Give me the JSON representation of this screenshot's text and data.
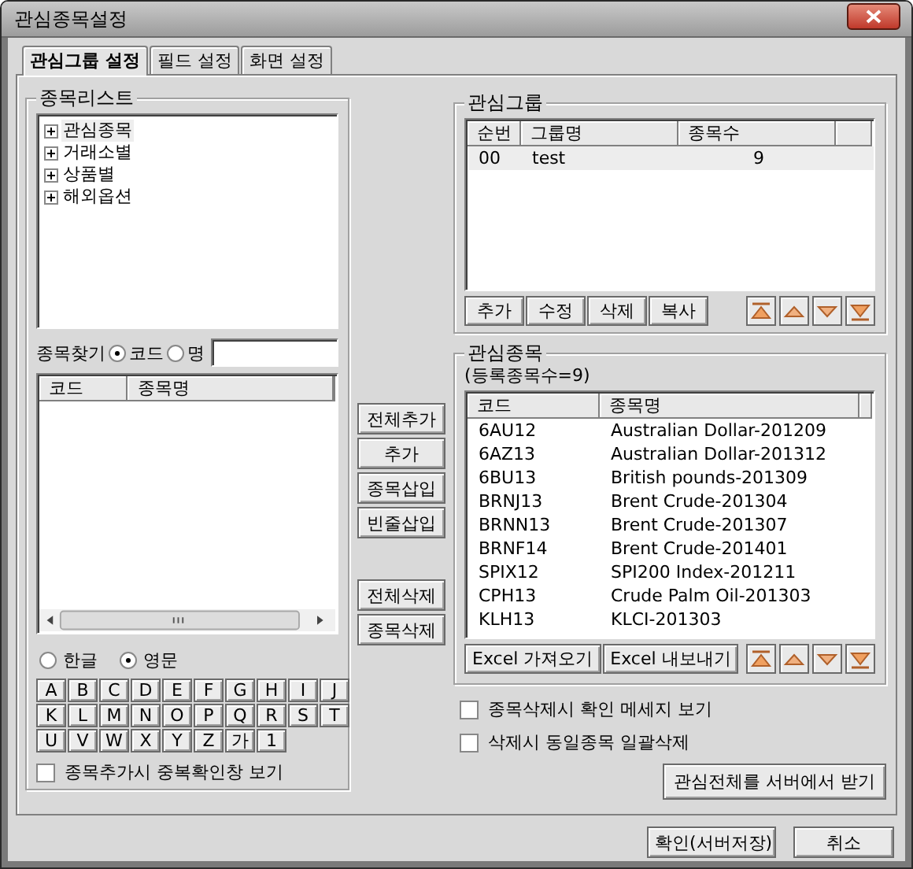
{
  "window": {
    "title": "관심종목설정"
  },
  "tabs": [
    {
      "label": "관심그룹 설정",
      "selected": true
    },
    {
      "label": "필드 설정",
      "selected": false
    },
    {
      "label": "화면 설정",
      "selected": false
    }
  ],
  "stock_list": {
    "title": "종목리스트",
    "tree": [
      {
        "label": "관심종목",
        "expanded": false,
        "selected": true
      },
      {
        "label": "거래소별",
        "expanded": false,
        "selected": false
      },
      {
        "label": "상품별",
        "expanded": false,
        "selected": false
      },
      {
        "label": "해외옵션",
        "expanded": false,
        "selected": false
      }
    ]
  },
  "search": {
    "label": "종목찾기",
    "options": [
      {
        "label": "코드",
        "selected": true
      },
      {
        "label": "명",
        "selected": false
      }
    ]
  },
  "search_results": {
    "columns": [
      "코드",
      "종목명"
    ]
  },
  "language": [
    {
      "label": "한글",
      "selected": false
    },
    {
      "label": "영문",
      "selected": true
    }
  ],
  "letter_keys": [
    "A",
    "B",
    "C",
    "D",
    "E",
    "F",
    "G",
    "H",
    "I",
    "J",
    "K",
    "L",
    "M",
    "N",
    "O",
    "P",
    "Q",
    "R",
    "S",
    "T",
    "U",
    "V",
    "W",
    "X",
    "Y",
    "Z",
    "가",
    "1"
  ],
  "duplicate_check": {
    "label": "종목추가시 중복확인창 보기",
    "checked": false
  },
  "transfer_buttons": {
    "add": [
      "전체추가",
      "추가",
      "종목삽입",
      "빈줄삽입"
    ],
    "remove": [
      "전체삭제",
      "종목삭제"
    ]
  },
  "groups": {
    "title": "관심그룹",
    "columns": [
      "순번",
      "그룹명",
      "종목수"
    ],
    "rows": [
      {
        "cells": [
          "00",
          "test",
          "9"
        ],
        "selected": true
      }
    ],
    "buttons": [
      "추가",
      "수정",
      "삭제",
      "복사"
    ]
  },
  "watchlist": {
    "title": "관심종목",
    "count": "(등록종목수=9)",
    "columns": [
      "코드",
      "종목명"
    ],
    "rows": [
      {
        "cells": [
          "6AU12",
          "Australian Dollar-201209"
        ]
      },
      {
        "cells": [
          "6AZ13",
          "Australian Dollar-201312"
        ]
      },
      {
        "cells": [
          "6BU13",
          "British pounds-201309"
        ]
      },
      {
        "cells": [
          "BRNJ13",
          "Brent Crude-201304"
        ]
      },
      {
        "cells": [
          "BRNN13",
          "Brent Crude-201307"
        ]
      },
      {
        "cells": [
          "BRNF14",
          "Brent Crude-201401"
        ]
      },
      {
        "cells": [
          "SPIX12",
          "SPI200 Index-201211"
        ]
      },
      {
        "cells": [
          "CPH13",
          "Crude Palm Oil-201303"
        ]
      },
      {
        "cells": [
          "KLH13",
          "KLCI-201303"
        ]
      }
    ],
    "buttons": [
      "Excel 가져오기",
      "Excel 내보내기"
    ]
  },
  "options": [
    {
      "label": "종목삭제시 확인 메세지 보기",
      "checked": false
    },
    {
      "label": "삭제시 동일종목 일괄삭제",
      "checked": false
    }
  ],
  "server_button": "관심전체를 서버에서 받기",
  "footer_buttons": [
    "확인(서버저장)",
    "취소"
  ]
}
